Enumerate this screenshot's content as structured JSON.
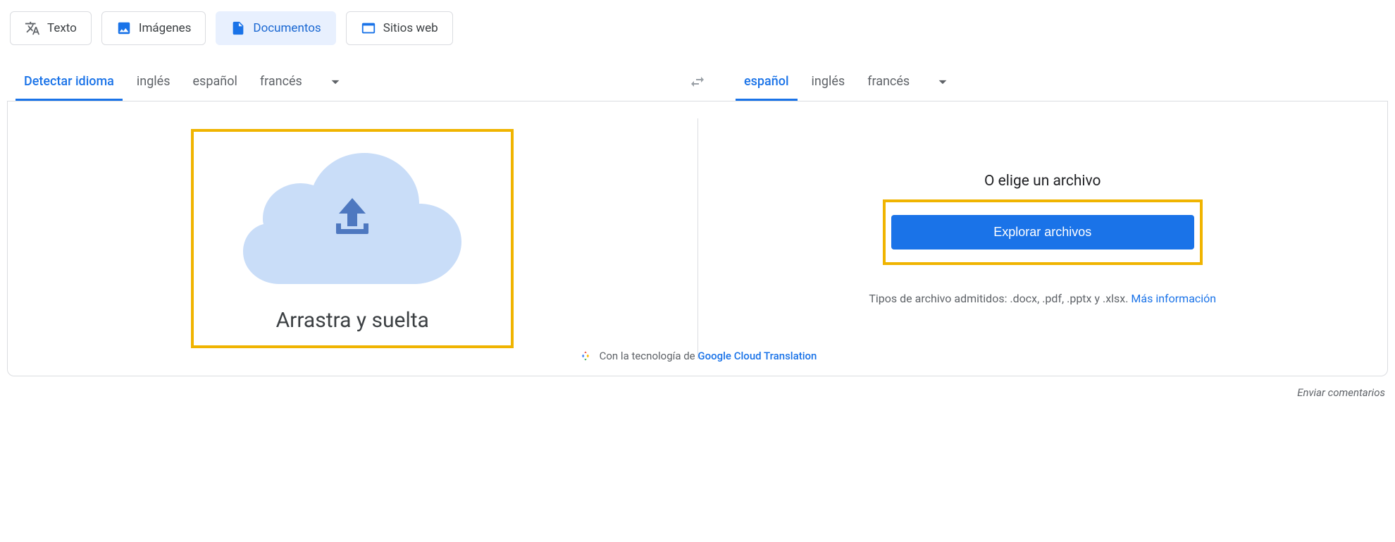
{
  "modeTabs": {
    "text": "Texto",
    "images": "Imágenes",
    "documents": "Documentos",
    "websites": "Sitios web"
  },
  "sourceLang": {
    "detect": "Detectar idioma",
    "en": "inglés",
    "es": "español",
    "fr": "francés"
  },
  "targetLang": {
    "es": "español",
    "en": "inglés",
    "fr": "francés"
  },
  "dropzone": {
    "label": "Arrastra y suelta"
  },
  "choose": {
    "label": "O elige un archivo",
    "browse": "Explorar archivos",
    "types": "Tipos de archivo admitidos: .docx, .pdf, .pptx y .xlsx. ",
    "moreInfo": "Más información"
  },
  "tech": {
    "prefix": "Con la tecnología de ",
    "link": "Google Cloud Translation"
  },
  "feedback": "Enviar comentarios"
}
